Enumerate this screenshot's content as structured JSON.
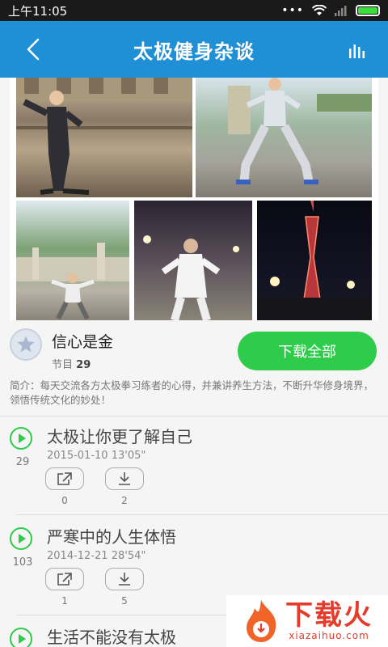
{
  "status_bar": {
    "time": "上午11:05",
    "dots": "•••"
  },
  "header": {
    "title": "太极健身杂谈"
  },
  "program": {
    "author": "信心是金",
    "episodes_label": "节目",
    "episodes_count": "29",
    "download_all": "下载全部",
    "description": "简介：每天交流各方太极拳习练者的心得，并兼讲养生方法，不断升华修身境界，领悟传统文化的妙处！"
  },
  "episodes": [
    {
      "title": "太极让你更了解自己",
      "date": "2015-01-10",
      "duration": "13'05\"",
      "plays": "29",
      "shares": "0",
      "downloads": "2"
    },
    {
      "title": "严寒中的人生体悟",
      "date": "2014-12-21",
      "duration": "28'54\"",
      "plays": "103",
      "shares": "1",
      "downloads": "5"
    },
    {
      "title": "生活不能没有太极",
      "date": "",
      "duration": "",
      "plays": "",
      "shares": "",
      "downloads": ""
    }
  ],
  "watermark": {
    "main": "下载火",
    "sub": "xiazaihuo.com"
  },
  "colors": {
    "header": "#1f8fd6",
    "accent_green": "#2ecc4a",
    "watermark_red": "#e63a2a"
  }
}
